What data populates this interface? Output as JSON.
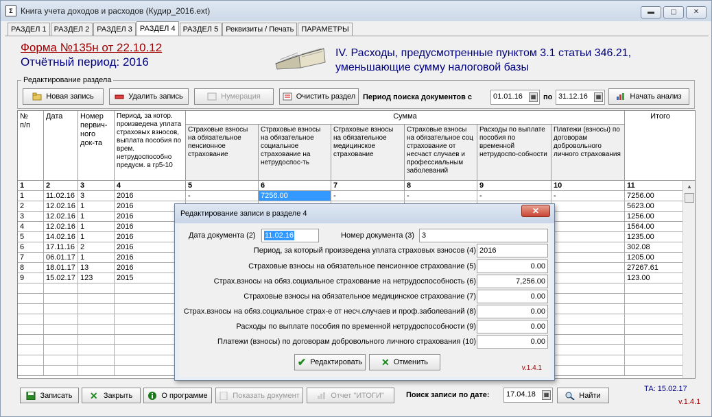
{
  "window": {
    "title": "Книга учета доходов и расходов (Кудир_2016.ext)",
    "min_label": "▬",
    "max_label": "▢",
    "close_label": "✕"
  },
  "tabs": [
    "РАЗДЕЛ 1",
    "РАЗДЕЛ 2",
    "РАЗДЕЛ 3",
    "РАЗДЕЛ 4",
    "РАЗДЕЛ 5",
    "Реквизиты / Печать",
    "ПАРАМЕТРЫ"
  ],
  "active_tab": "РАЗДЕЛ 4",
  "header": {
    "form_title": "Форма №135н от 22.10.12",
    "period_label": "Отчётный период:  2016",
    "section_title_1": "IV. Расходы, предусмотренные пунктом 3.1 статьи 346.21,",
    "section_title_2": "уменьшающие сумму налоговой базы"
  },
  "edit_group": {
    "label": "Редактирование раздела",
    "new_record": "Новая запись",
    "delete_record": "Удалить запись",
    "numbering": "Нумерация",
    "clear_section": "Очистить раздел",
    "search_period_label": "Период поиска документов с",
    "date_from": "01.01.16",
    "to_label": "по",
    "date_to": "31.12.16",
    "start_analysis": "Начать анализ"
  },
  "table": {
    "headers": {
      "num": "№\nп/п",
      "date": "Дата",
      "doc_num": "Номер первич-ного док-та",
      "period": "Период, за котор. произведена уплата страховых взносов, выплата пособия по врем. нетрудоспособно предусм. в гр5-10",
      "sum": "Сумма",
      "c5": "Страховые взносы на обязательное пенсионное страхование",
      "c6": "Страховые взносы на обязательное социальное страхование на нетрудоспос-ть",
      "c7": "Страховые взносы на обязательное медицинское страхование",
      "c8": "Страховые взносы на обязательное соц страхование от несчаст случаев и профессиальным заболеваний",
      "c9": "Расходы по выплате пособия по временной нетрудоспо-собности",
      "c10": "Платежи (взносы) по договорам добровольного личного страхования",
      "total": "Итого"
    },
    "col_numbers": [
      "1",
      "2",
      "3",
      "4",
      "5",
      "6",
      "7",
      "8",
      "9",
      "10",
      "11"
    ],
    "rows": [
      {
        "n": "1",
        "date": "11.02.16",
        "doc": "3",
        "period": "2016",
        "c5": "-",
        "c6": "7256.00",
        "c7": "-",
        "c8": "-",
        "c9": "-",
        "c10": "-",
        "total": "7256.00"
      },
      {
        "n": "2",
        "date": "12.02.16",
        "doc": "1",
        "period": "2016",
        "c5": "",
        "c6": "",
        "c7": "",
        "c8": "",
        "c9": "",
        "c10": "",
        "total": "5623.00"
      },
      {
        "n": "3",
        "date": "12.02.16",
        "doc": "1",
        "period": "2016",
        "c5": "",
        "c6": "",
        "c7": "",
        "c8": "",
        "c9": "",
        "c10": "",
        "total": "1256.00"
      },
      {
        "n": "4",
        "date": "12.02.16",
        "doc": "1",
        "period": "2016",
        "c5": "",
        "c6": "",
        "c7": "",
        "c8": "",
        "c9": "",
        "c10": "",
        "total": "1564.00"
      },
      {
        "n": "5",
        "date": "14.02.16",
        "doc": "1",
        "period": "2016",
        "c5": "",
        "c6": "",
        "c7": "",
        "c8": "",
        "c9": "",
        "c10": "",
        "total": "1235.00"
      },
      {
        "n": "6",
        "date": "17.11.16",
        "doc": "2",
        "period": "2016",
        "c5": "",
        "c6": "",
        "c7": "",
        "c8": "",
        "c9": "",
        "c10": "",
        "total": "302.08"
      },
      {
        "n": "7",
        "date": "06.01.17",
        "doc": "1",
        "period": "2016",
        "c5": "",
        "c6": "",
        "c7": "",
        "c8": "",
        "c9": "",
        "c10": "",
        "total": "1205.00"
      },
      {
        "n": "8",
        "date": "18.01.17",
        "doc": "13",
        "period": "2016",
        "c5": "",
        "c6": "",
        "c7": "",
        "c8": "",
        "c9": "",
        "c10": "",
        "total": "27267.61"
      },
      {
        "n": "9",
        "date": "15.02.17",
        "doc": "123",
        "period": "2015",
        "c5": "",
        "c6": "",
        "c7": "",
        "c8": "",
        "c9": "",
        "c10": "",
        "total": "123.00"
      }
    ]
  },
  "footer": {
    "save": "Записать",
    "close": "Закрыть",
    "about": "О программе",
    "show_doc": "Показать документ",
    "report": "Отчет \"ИТОГИ\"",
    "search_label": "Поиск записи по дате:",
    "search_date": "17.04.18",
    "find": "Найти",
    "ta": "ТА: 15.02.17",
    "version": "v.1.4.1"
  },
  "dialog": {
    "title": "Редактирование записи в разделе 4",
    "close_label": "✕",
    "doc_date_label": "Дата документа (2)",
    "doc_date": "11.02.16",
    "doc_num_label": "Номер документа (3)",
    "doc_num": "3",
    "period_label": "Период, за который произведена уплата страховых взносов (4)",
    "period": "2016",
    "f5_label": "Страховые взносы на обязательное пенсионное страхование (5)",
    "f5": "0.00",
    "f6_label": "Страх.взносы на обяз.социальное страхование на нетрудоспособность (6)",
    "f6": "7,256.00",
    "f7_label": "Страховые взносы на обязательное медицинское страхование (7)",
    "f7": "0.00",
    "f8_label": "Страх.взносы на обяз.социальное страх-е от несч.случаев и проф.заболеваний (8)",
    "f8": "0.00",
    "f9_label": "Расходы по выплате пособия по временной нетрудоспособности (9)",
    "f9": "0.00",
    "f10_label": "Платежи (взносы) по договорам добровольного личного страхования (10)",
    "f10": "0.00",
    "edit_button": "Редактировать",
    "cancel_button": "Отменить",
    "version": "v.1.4.1"
  },
  "colors": {
    "form_title": "#a00000",
    "accent_blue": "#000080",
    "selection": "#3399ff"
  }
}
